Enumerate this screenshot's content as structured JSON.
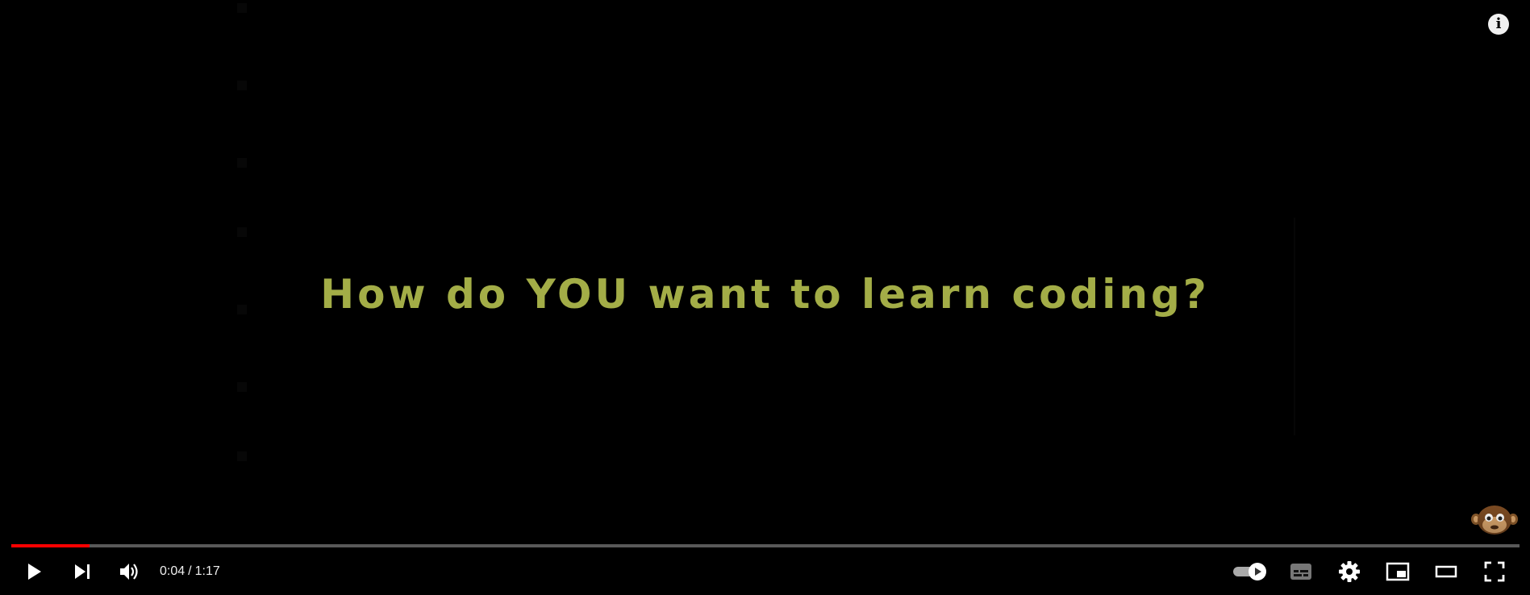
{
  "video": {
    "headline": "How do YOU want to learn coding?",
    "headline_color": "#a3ad47"
  },
  "player": {
    "info_icon": "info-icon",
    "watermark_icon": "monkey-mascot-icon",
    "progress": {
      "played_fraction": 0.052,
      "played_color": "#ff0000"
    },
    "time": {
      "current": "0:04",
      "separator": "/",
      "duration": "1:17"
    },
    "controls": {
      "left": [
        "play-icon",
        "next-icon",
        "volume-icon"
      ],
      "right": [
        "autoplay-toggle-icon",
        "subtitles-icon",
        "settings-gear-icon",
        "miniplayer-icon",
        "theater-mode-icon",
        "fullscreen-icon"
      ]
    }
  }
}
